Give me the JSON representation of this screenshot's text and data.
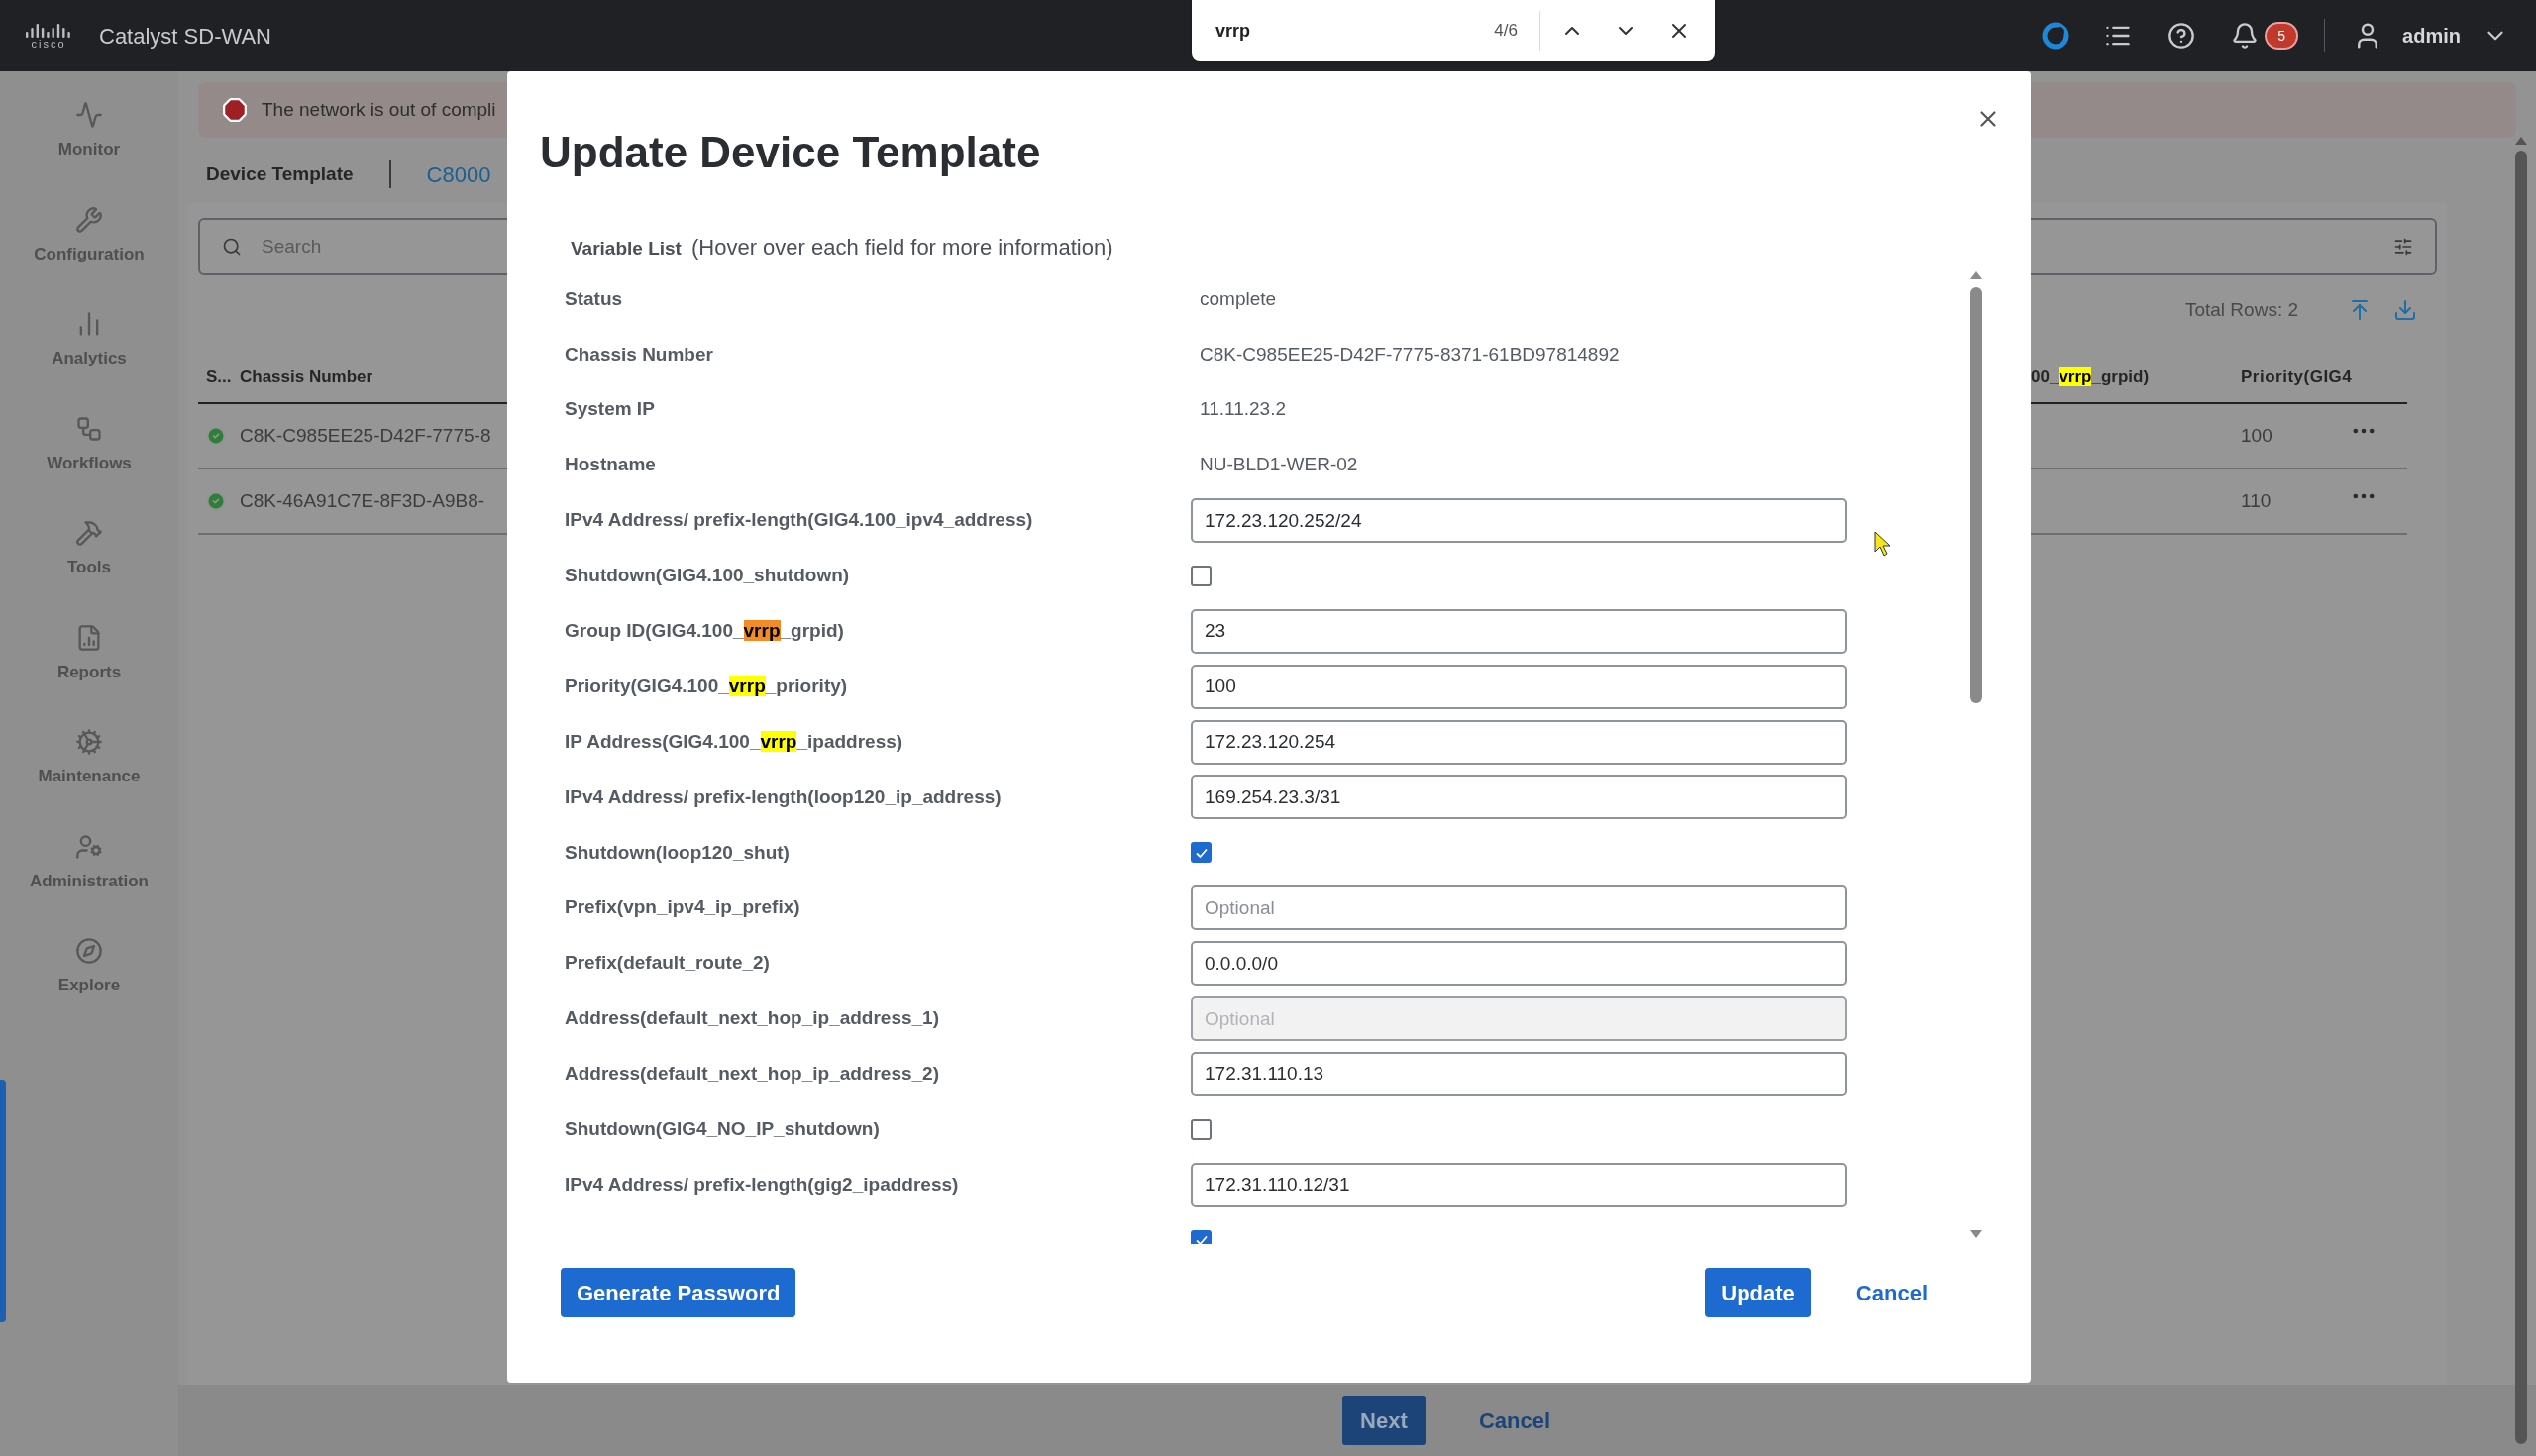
{
  "top_bar": {
    "logo_text": "cisco",
    "product": "Catalyst SD-WAN",
    "notifications": "5",
    "user": "admin"
  },
  "find_bar": {
    "query": "vrrp",
    "count": "4/6"
  },
  "sidebar": {
    "items": [
      {
        "label": "Monitor",
        "kind": "monitor"
      },
      {
        "label": "Configuration",
        "kind": "configuration"
      },
      {
        "label": "Analytics",
        "kind": "analytics"
      },
      {
        "label": "Workflows",
        "kind": "workflows"
      },
      {
        "label": "Tools",
        "kind": "tools"
      },
      {
        "label": "Reports",
        "kind": "reports"
      },
      {
        "label": "Maintenance",
        "kind": "maintenance"
      },
      {
        "label": "Administration",
        "kind": "administration"
      },
      {
        "label": "Explore",
        "kind": "explore"
      }
    ]
  },
  "banner": {
    "text": "The network is out of compli"
  },
  "breadcrumb": {
    "title": "Device Template",
    "link": "C8000"
  },
  "search": {
    "placeholder": "Search"
  },
  "total_rows": "Total Rows: 2",
  "table": {
    "columns_left": [
      "S...",
      "Chassis Number"
    ],
    "columns_right": [
      {
        "parts": [
          {
            "text": "00_"
          },
          {
            "text": "vrrp",
            "highlight": true,
            "current": false
          },
          {
            "text": "_grpid)"
          }
        ]
      },
      {
        "parts": [
          {
            "text": "Priority(GIG4"
          }
        ]
      }
    ],
    "rows": [
      {
        "complete": true,
        "chassis": "C8K-C985EE25-D42F-7775-8",
        "priority": "100"
      },
      {
        "complete": true,
        "chassis": "C8K-46A91C7E-8F3D-A9B8-",
        "priority": "110"
      }
    ]
  },
  "modal": {
    "title": "Update Device Template",
    "section": "Variable List",
    "hint": "(Hover over each field for more information)",
    "rows": [
      {
        "kind": "text",
        "label": [
          {
            "text": "Status"
          }
        ],
        "value": "complete"
      },
      {
        "kind": "text",
        "label": [
          {
            "text": "Chassis Number"
          }
        ],
        "value": "C8K-C985EE25-D42F-7775-8371-61BD97814892"
      },
      {
        "kind": "text",
        "label": [
          {
            "text": "System IP"
          }
        ],
        "value": "11.11.23.2"
      },
      {
        "kind": "text",
        "label": [
          {
            "text": "Hostname"
          }
        ],
        "value": "NU-BLD1-WER-02"
      },
      {
        "kind": "input",
        "label": [
          {
            "text": "IPv4 Address/ prefix-length(GIG4.100_ipv4_address)"
          }
        ],
        "value": "172.23.120.252/24",
        "disabled": false
      },
      {
        "kind": "checkbox",
        "label": [
          {
            "text": "Shutdown(GIG4.100_shutdown)"
          }
        ],
        "checked": false
      },
      {
        "kind": "input",
        "label": [
          {
            "text": "Group ID(GIG4.100_"
          },
          {
            "text": "vrrp",
            "highlight": true,
            "current": true
          },
          {
            "text": "_grpid)"
          }
        ],
        "value": "23",
        "disabled": false
      },
      {
        "kind": "input",
        "label": [
          {
            "text": "Priority(GIG4.100_"
          },
          {
            "text": "vrrp",
            "highlight": true,
            "current": false
          },
          {
            "text": "_priority)"
          }
        ],
        "value": "100",
        "disabled": false
      },
      {
        "kind": "input",
        "label": [
          {
            "text": "IP Address(GIG4.100_"
          },
          {
            "text": "vrrp",
            "highlight": true,
            "current": false
          },
          {
            "text": "_ipaddress)"
          }
        ],
        "value": "172.23.120.254",
        "disabled": false
      },
      {
        "kind": "input",
        "label": [
          {
            "text": "IPv4 Address/ prefix-length(loop120_ip_address)"
          }
        ],
        "value": "169.254.23.3/31",
        "disabled": false
      },
      {
        "kind": "checkbox",
        "label": [
          {
            "text": "Shutdown(loop120_shut)"
          }
        ],
        "checked": true
      },
      {
        "kind": "input",
        "label": [
          {
            "text": "Prefix(vpn_ipv4_ip_prefix)"
          }
        ],
        "placeholder": "Optional",
        "disabled": false
      },
      {
        "kind": "input",
        "label": [
          {
            "text": "Prefix(default_route_2)"
          }
        ],
        "value": "0.0.0.0/0",
        "disabled": false
      },
      {
        "kind": "input",
        "label": [
          {
            "text": "Address(default_next_hop_ip_address_1)"
          }
        ],
        "placeholder": "Optional",
        "disabled": true
      },
      {
        "kind": "input",
        "label": [
          {
            "text": "Address(default_next_hop_ip_address_2)"
          }
        ],
        "value": "172.31.110.13",
        "disabled": false
      },
      {
        "kind": "checkbox",
        "label": [
          {
            "text": "Shutdown(GIG4_NO_IP_shutdown)"
          }
        ],
        "checked": false
      },
      {
        "kind": "input",
        "label": [
          {
            "text": "IPv4 Address/ prefix-length(gig2_ipaddress)"
          }
        ],
        "value": "172.31.110.12/31",
        "disabled": false
      },
      {
        "kind": "checkbox",
        "checked": true
      }
    ],
    "buttons": {
      "generate": "Generate Password",
      "update": "Update",
      "cancel": "Cancel"
    }
  },
  "footer": {
    "next": "Next",
    "cancel": "Cancel"
  }
}
